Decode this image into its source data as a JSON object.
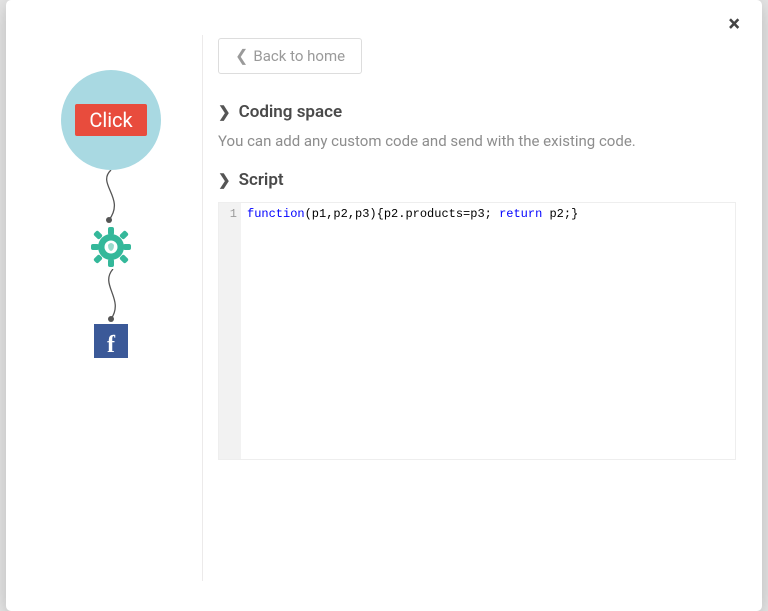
{
  "modal": {
    "close_label": "×"
  },
  "flow": {
    "node1_label": "Click",
    "gear_name": "gear-icon",
    "fb_glyph": "f"
  },
  "back_button": {
    "label": "Back to home"
  },
  "sections": {
    "coding_space": {
      "title": "Coding space",
      "description": "You can add any custom code and send with the existing code."
    },
    "script": {
      "title": "Script"
    }
  },
  "editor": {
    "line_numbers": [
      "1"
    ],
    "code_plain": "function(p1,p2,p3){p2.products=p3; return p2;}",
    "tokens": [
      {
        "t": "function",
        "c": "kw"
      },
      {
        "t": "(p1,p2,p3){p2",
        "c": "ident"
      },
      {
        "t": ".",
        "c": "ident"
      },
      {
        "t": "products",
        "c": "prop"
      },
      {
        "t": "=",
        "c": "ident"
      },
      {
        "t": "p3",
        "c": "ident"
      },
      {
        "t": "; ",
        "c": "ident"
      },
      {
        "t": "return",
        "c": "kw"
      },
      {
        "t": " p2;}",
        "c": "ident"
      }
    ]
  }
}
